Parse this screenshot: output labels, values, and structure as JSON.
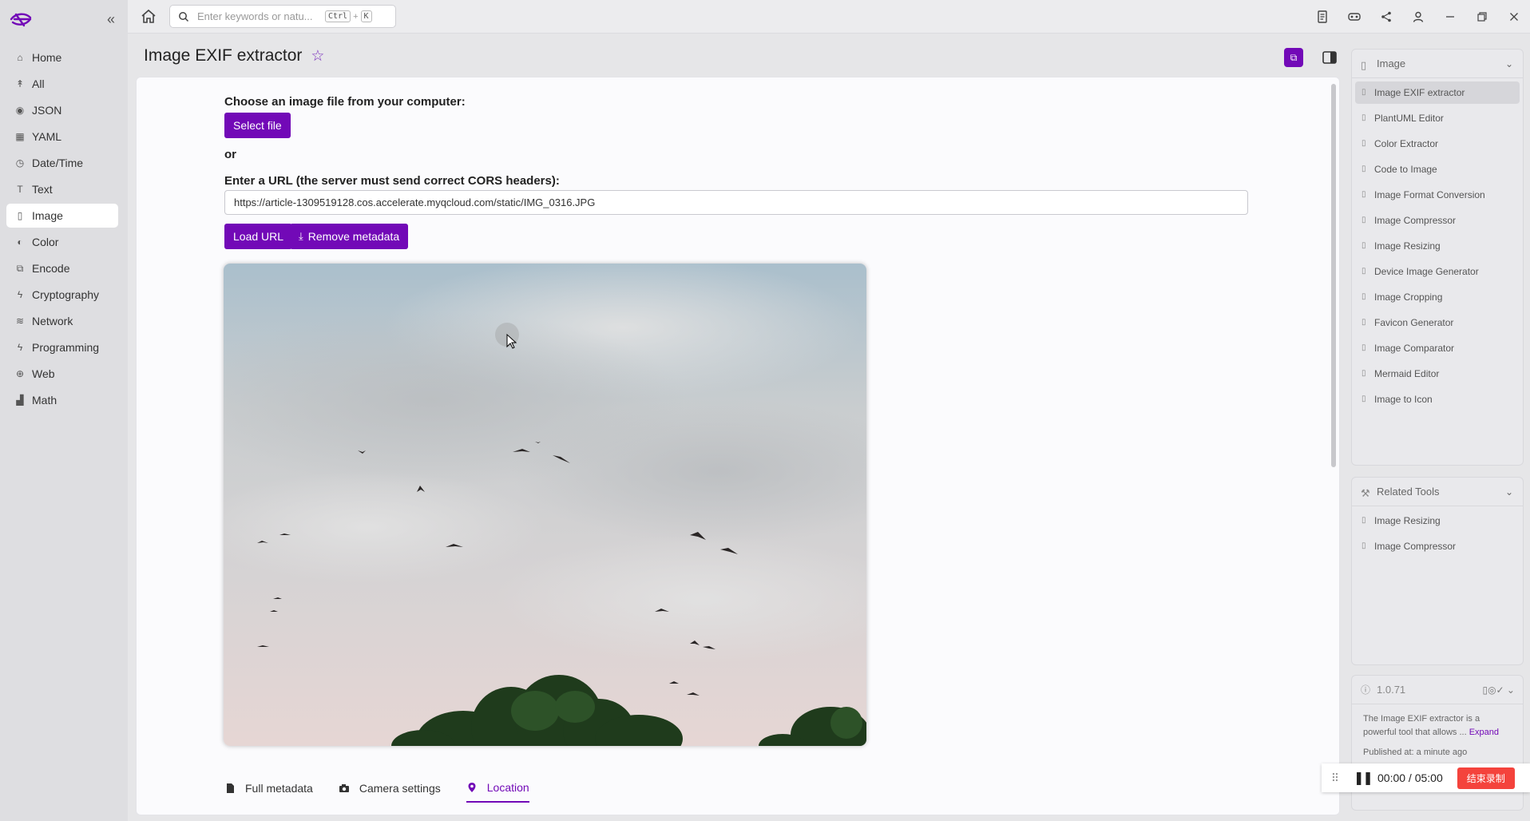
{
  "app": {
    "title": "Image EXIF extractor"
  },
  "sidebar": {
    "items": [
      {
        "label": "Home",
        "icon": "home-icon"
      },
      {
        "label": "All",
        "icon": "rocket-icon"
      },
      {
        "label": "JSON",
        "icon": "json-icon"
      },
      {
        "label": "YAML",
        "icon": "grid-icon"
      },
      {
        "label": "Date/Time",
        "icon": "clock-icon"
      },
      {
        "label": "Text",
        "icon": "text-icon"
      },
      {
        "label": "Image",
        "icon": "file-icon",
        "active": true
      },
      {
        "label": "Color",
        "icon": "palette-icon"
      },
      {
        "label": "Encode",
        "icon": "encode-icon"
      },
      {
        "label": "Cryptography",
        "icon": "bolt-icon"
      },
      {
        "label": "Network",
        "icon": "wifi-icon"
      },
      {
        "label": "Programming",
        "icon": "bolt-icon"
      },
      {
        "label": "Web",
        "icon": "globe-icon"
      },
      {
        "label": "Math",
        "icon": "chart-icon"
      }
    ]
  },
  "topbar": {
    "search_placeholder": "Enter keywords or natu...",
    "shortcut_key1": "Ctrl",
    "shortcut_plus": "+",
    "shortcut_key2": "K"
  },
  "main": {
    "title": "Image EXIF extractor",
    "choose_label": "Choose an image file from your computer:",
    "select_file_label": "Select file",
    "or_label": "or",
    "url_label": "Enter a URL (the server must send correct CORS headers):",
    "url_value": "https://article-1309519128.cos.accelerate.myqcloud.com/static/IMG_0316.JPG",
    "load_url_label": "Load URL",
    "remove_metadata_label": "Remove metadata",
    "tabs": [
      {
        "label": "Full metadata",
        "icon": "file-icon"
      },
      {
        "label": "Camera settings",
        "icon": "camera-icon"
      },
      {
        "label": "Location",
        "icon": "location-pin-icon",
        "active": true
      }
    ]
  },
  "right_panel": {
    "category": {
      "title": "Image",
      "items": [
        "Image EXIF extractor",
        "PlantUML Editor",
        "Color Extractor",
        "Code to Image",
        "Image Format Conversion",
        "Image Compressor",
        "Image Resizing",
        "Device Image Generator",
        "Image Cropping",
        "Favicon Generator",
        "Image Comparator",
        "Mermaid Editor",
        "Image to Icon"
      ],
      "active_index": 0
    },
    "related": {
      "title": "Related Tools",
      "items": [
        "Image Resizing",
        "Image Compressor"
      ]
    },
    "info": {
      "version": "1.0.71",
      "description": "The Image EXIF extractor is a powerful tool that allows ...",
      "expand_label": "Expand",
      "published": "Published at: a minute ago"
    }
  },
  "recorder": {
    "time": "00:00 / 05:00",
    "stop_label": "结束录制"
  },
  "colors": {
    "accent": "#7209b7",
    "stop": "#f4433c"
  }
}
